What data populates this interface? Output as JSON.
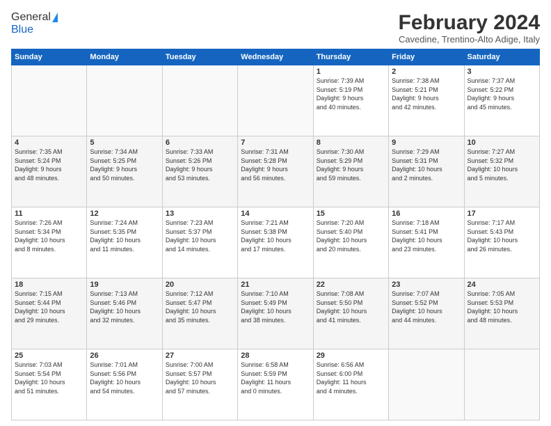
{
  "header": {
    "logo_general": "General",
    "logo_blue": "Blue",
    "month_year": "February 2024",
    "location": "Cavedine, Trentino-Alto Adige, Italy"
  },
  "days_of_week": [
    "Sunday",
    "Monday",
    "Tuesday",
    "Wednesday",
    "Thursday",
    "Friday",
    "Saturday"
  ],
  "weeks": [
    [
      {
        "day": "",
        "info": ""
      },
      {
        "day": "",
        "info": ""
      },
      {
        "day": "",
        "info": ""
      },
      {
        "day": "",
        "info": ""
      },
      {
        "day": "1",
        "info": "Sunrise: 7:39 AM\nSunset: 5:19 PM\nDaylight: 9 hours\nand 40 minutes."
      },
      {
        "day": "2",
        "info": "Sunrise: 7:38 AM\nSunset: 5:21 PM\nDaylight: 9 hours\nand 42 minutes."
      },
      {
        "day": "3",
        "info": "Sunrise: 7:37 AM\nSunset: 5:22 PM\nDaylight: 9 hours\nand 45 minutes."
      }
    ],
    [
      {
        "day": "4",
        "info": "Sunrise: 7:35 AM\nSunset: 5:24 PM\nDaylight: 9 hours\nand 48 minutes."
      },
      {
        "day": "5",
        "info": "Sunrise: 7:34 AM\nSunset: 5:25 PM\nDaylight: 9 hours\nand 50 minutes."
      },
      {
        "day": "6",
        "info": "Sunrise: 7:33 AM\nSunset: 5:26 PM\nDaylight: 9 hours\nand 53 minutes."
      },
      {
        "day": "7",
        "info": "Sunrise: 7:31 AM\nSunset: 5:28 PM\nDaylight: 9 hours\nand 56 minutes."
      },
      {
        "day": "8",
        "info": "Sunrise: 7:30 AM\nSunset: 5:29 PM\nDaylight: 9 hours\nand 59 minutes."
      },
      {
        "day": "9",
        "info": "Sunrise: 7:29 AM\nSunset: 5:31 PM\nDaylight: 10 hours\nand 2 minutes."
      },
      {
        "day": "10",
        "info": "Sunrise: 7:27 AM\nSunset: 5:32 PM\nDaylight: 10 hours\nand 5 minutes."
      }
    ],
    [
      {
        "day": "11",
        "info": "Sunrise: 7:26 AM\nSunset: 5:34 PM\nDaylight: 10 hours\nand 8 minutes."
      },
      {
        "day": "12",
        "info": "Sunrise: 7:24 AM\nSunset: 5:35 PM\nDaylight: 10 hours\nand 11 minutes."
      },
      {
        "day": "13",
        "info": "Sunrise: 7:23 AM\nSunset: 5:37 PM\nDaylight: 10 hours\nand 14 minutes."
      },
      {
        "day": "14",
        "info": "Sunrise: 7:21 AM\nSunset: 5:38 PM\nDaylight: 10 hours\nand 17 minutes."
      },
      {
        "day": "15",
        "info": "Sunrise: 7:20 AM\nSunset: 5:40 PM\nDaylight: 10 hours\nand 20 minutes."
      },
      {
        "day": "16",
        "info": "Sunrise: 7:18 AM\nSunset: 5:41 PM\nDaylight: 10 hours\nand 23 minutes."
      },
      {
        "day": "17",
        "info": "Sunrise: 7:17 AM\nSunset: 5:43 PM\nDaylight: 10 hours\nand 26 minutes."
      }
    ],
    [
      {
        "day": "18",
        "info": "Sunrise: 7:15 AM\nSunset: 5:44 PM\nDaylight: 10 hours\nand 29 minutes."
      },
      {
        "day": "19",
        "info": "Sunrise: 7:13 AM\nSunset: 5:46 PM\nDaylight: 10 hours\nand 32 minutes."
      },
      {
        "day": "20",
        "info": "Sunrise: 7:12 AM\nSunset: 5:47 PM\nDaylight: 10 hours\nand 35 minutes."
      },
      {
        "day": "21",
        "info": "Sunrise: 7:10 AM\nSunset: 5:49 PM\nDaylight: 10 hours\nand 38 minutes."
      },
      {
        "day": "22",
        "info": "Sunrise: 7:08 AM\nSunset: 5:50 PM\nDaylight: 10 hours\nand 41 minutes."
      },
      {
        "day": "23",
        "info": "Sunrise: 7:07 AM\nSunset: 5:52 PM\nDaylight: 10 hours\nand 44 minutes."
      },
      {
        "day": "24",
        "info": "Sunrise: 7:05 AM\nSunset: 5:53 PM\nDaylight: 10 hours\nand 48 minutes."
      }
    ],
    [
      {
        "day": "25",
        "info": "Sunrise: 7:03 AM\nSunset: 5:54 PM\nDaylight: 10 hours\nand 51 minutes."
      },
      {
        "day": "26",
        "info": "Sunrise: 7:01 AM\nSunset: 5:56 PM\nDaylight: 10 hours\nand 54 minutes."
      },
      {
        "day": "27",
        "info": "Sunrise: 7:00 AM\nSunset: 5:57 PM\nDaylight: 10 hours\nand 57 minutes."
      },
      {
        "day": "28",
        "info": "Sunrise: 6:58 AM\nSunset: 5:59 PM\nDaylight: 11 hours\nand 0 minutes."
      },
      {
        "day": "29",
        "info": "Sunrise: 6:56 AM\nSunset: 6:00 PM\nDaylight: 11 hours\nand 4 minutes."
      },
      {
        "day": "",
        "info": ""
      },
      {
        "day": "",
        "info": ""
      }
    ]
  ]
}
